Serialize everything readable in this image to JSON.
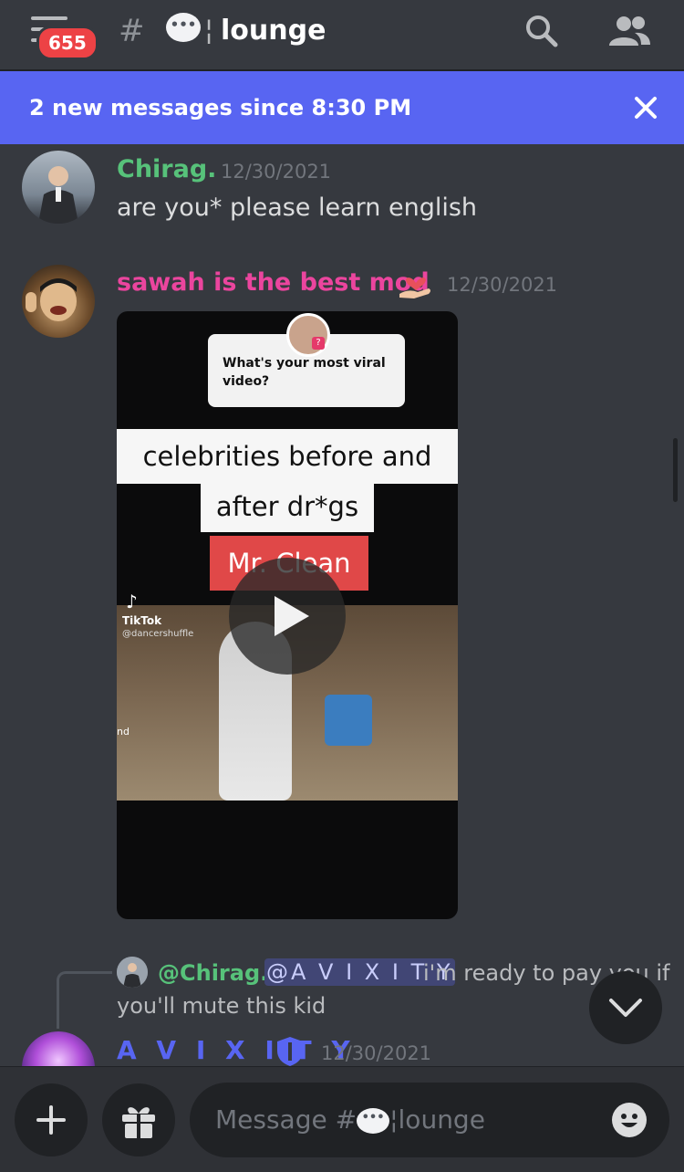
{
  "header": {
    "notification_count": "655",
    "channel_hash": "#",
    "channel_emoji_label": "speech-balloon-emoji",
    "channel_separator": "¦",
    "channel_name": "lounge"
  },
  "new_messages_bar": {
    "text": "2 new messages since 8:30 PM"
  },
  "messages": [
    {
      "author": "Chirag.",
      "author_color": "#57c27a",
      "timestamp": "12/30/2021",
      "text": "are you* please learn english"
    },
    {
      "author": "sawah is the best mod",
      "author_color": "#eb459e",
      "timestamp": "12/30/2021",
      "attachment": {
        "type": "video",
        "question": "What's your most viral video?",
        "caption_line1": "celebrities before and",
        "caption_line2": "after dr*gs",
        "caption_label": "Mr. Clean",
        "watermark": "TikTok",
        "handle": "@dancershuffle",
        "question_badge": "?",
        "frame_mark": "nd"
      }
    },
    {
      "reply_to_author": "@Chirag.",
      "reply_mention": "@A V I X I T Y",
      "reply_text_line1": "i'm ready to pay you if",
      "reply_text_line2": "you'll mute this kid",
      "author": "A V I X I T Y",
      "author_color": "#5865f2",
      "timestamp": "12/30/2021"
    }
  ],
  "composer": {
    "placeholder_prefix": "Message #",
    "placeholder_separator": "¦",
    "placeholder_channel": "lounge"
  }
}
